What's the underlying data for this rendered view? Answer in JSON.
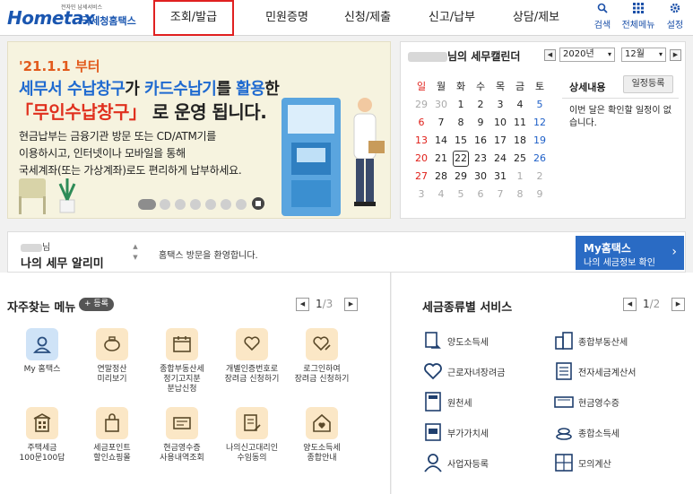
{
  "header": {
    "logo_small": "전자민 납세서비스",
    "logo_main": "Hometax",
    "logo_sub": "국세청홈택스",
    "nav": [
      "조회/발급",
      "민원증명",
      "신청/제출",
      "신고/납부",
      "상담/제보"
    ],
    "utils": {
      "search": "검색",
      "all_menu": "전체메뉴",
      "settings": "설정"
    }
  },
  "banner": {
    "date": "'21.1.1 부터",
    "line2_a": "세무서 수납창구",
    "line2_b": "가 ",
    "line2_c": "카드수납기",
    "line2_d": "를 ",
    "line2_e": "활용",
    "line2_f": "한",
    "line3_a": "「무인수납창구」",
    "line3_b": " 로 운영 됩니다.",
    "body1": "현금납부는 금융기관 방문 또는 CD/ATM기를",
    "body2": "이용하시고, 인터넷이나 모바일을 통해",
    "body3": "국세계좌(또는 가상계좌)로도 편리하게 납부하세요."
  },
  "calendar": {
    "title_suffix": "님의 세무캘린더",
    "year": "2020년",
    "month": "12월",
    "weekdays": [
      "일",
      "월",
      "화",
      "수",
      "목",
      "금",
      "토"
    ],
    "rows": [
      [
        "29",
        "30",
        "1",
        "2",
        "3",
        "4",
        "5"
      ],
      [
        "6",
        "7",
        "8",
        "9",
        "10",
        "11",
        "12"
      ],
      [
        "13",
        "14",
        "15",
        "16",
        "17",
        "18",
        "19"
      ],
      [
        "20",
        "21",
        "22",
        "23",
        "24",
        "25",
        "26"
      ],
      [
        "27",
        "28",
        "29",
        "30",
        "31",
        "1",
        "2"
      ],
      [
        "3",
        "4",
        "5",
        "6",
        "7",
        "8",
        "9"
      ]
    ],
    "today": "22",
    "detail_title": "상세내용",
    "detail_button": "일정등록",
    "detail_message": "이번 달은 확인할 일정이 없습니다."
  },
  "alert": {
    "user_suffix": "님",
    "title": "나의 세무 알리미",
    "message": "홈택스 방문을 환영합니다.",
    "my_btn_title": "My홈택스",
    "my_btn_sub": "나의 세금정보 확인"
  },
  "quick_menu": {
    "title": "자주찾는 메뉴",
    "add": "등록",
    "page": "1",
    "total": "/3",
    "items": [
      {
        "label": "My 홈택스",
        "icon": "user-icon"
      },
      {
        "label": "연말정산\n미리보기",
        "icon": "piggy-bank-icon"
      },
      {
        "label": "종합부동산세\n정기고지분\n분납신청",
        "icon": "calendar-icon"
      },
      {
        "label": "개별인증번호로\n장려금 신청하기",
        "icon": "heart-hand-icon"
      },
      {
        "label": "로그인하여\n장려금 신청하기",
        "icon": "heart-pen-icon"
      },
      {
        "label": "주택세금\n100문100답",
        "icon": "building-icon"
      },
      {
        "label": "세금포인트\n할인쇼핑몰",
        "icon": "shopping-bag-icon"
      },
      {
        "label": "현금영수증\n사용내역조회",
        "icon": "receipt-icon"
      },
      {
        "label": "나의신고대리인\n수임동의",
        "icon": "document-pen-icon"
      },
      {
        "label": "양도소득세\n종합안내",
        "icon": "house-heart-icon"
      }
    ]
  },
  "tax_services": {
    "title": "세금종류별 서비스",
    "page": "1",
    "total": "/2",
    "items": [
      {
        "label": "양도소득세",
        "icon": "transfer-doc-icon"
      },
      {
        "label": "종합부동산세",
        "icon": "buildings-icon"
      },
      {
        "label": "근로자녀장려금",
        "icon": "heart-icon"
      },
      {
        "label": "전자세금계산서",
        "icon": "invoice-icon"
      },
      {
        "label": "원천세",
        "icon": "calculator-icon"
      },
      {
        "label": "현금영수증",
        "icon": "cash-icon"
      },
      {
        "label": "부가가치세",
        "icon": "vat-icon"
      },
      {
        "label": "종합소득세",
        "icon": "coins-icon"
      },
      {
        "label": "사업자등록",
        "icon": "person-icon"
      },
      {
        "label": "모의계산",
        "icon": "calc-grid-icon"
      }
    ]
  },
  "colors": {
    "brand_blue": "#1a56b0",
    "accent_orange": "#e25a1c",
    "accent_red": "#e0301e",
    "my_btn": "#2a6bc4"
  }
}
